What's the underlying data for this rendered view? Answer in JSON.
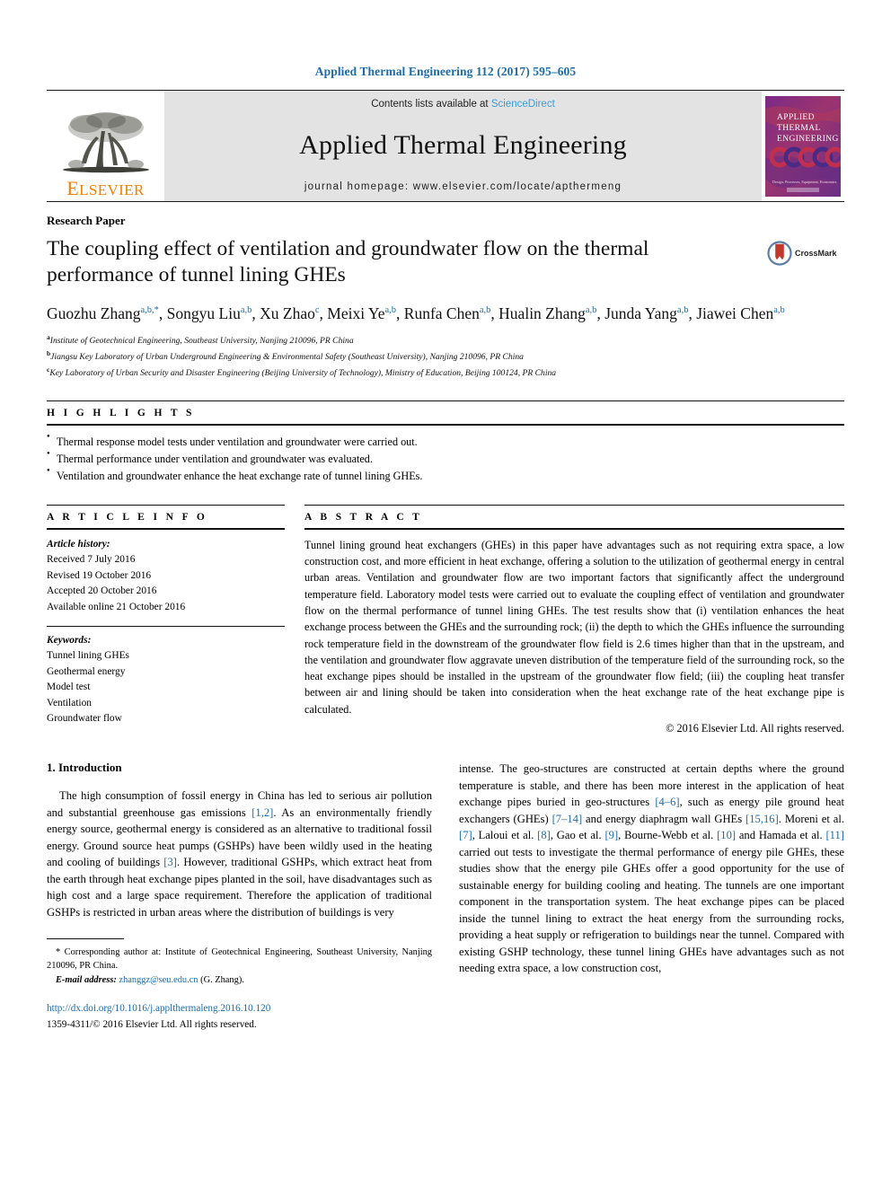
{
  "running_head": "Applied Thermal Engineering 112 (2017) 595–605",
  "masthead": {
    "publisher": "ELSEVIER",
    "publisher_first": "E",
    "publisher_rest": "LSEVIER",
    "contents_prefix": "Contents lists available at ",
    "contents_link": "ScienceDirect",
    "journal_name": "Applied Thermal Engineering",
    "homepage": "journal homepage: www.elsevier.com/locate/apthermeng",
    "cover": {
      "line1": "APPLIED",
      "line2": "THERMAL",
      "line3": "ENGINEERING",
      "footer": "Design, Processes, Equipment, Economics",
      "colors": {
        "top": "#6e2a7a",
        "mid": "#b63a52",
        "accent": "#d0394f",
        "dark": "#4a2b7a"
      }
    }
  },
  "article_type": "Research Paper",
  "title": "The coupling effect of ventilation and groundwater flow on the thermal performance of tunnel lining GHEs",
  "crossmark": {
    "label": "CrossMark"
  },
  "authors": [
    {
      "name": "Guozhu Zhang",
      "sup": "a,b,*"
    },
    {
      "name": "Songyu Liu",
      "sup": "a,b"
    },
    {
      "name": "Xu Zhao",
      "sup": "c"
    },
    {
      "name": "Meixi Ye",
      "sup": "a,b"
    },
    {
      "name": "Runfa Chen",
      "sup": "a,b"
    },
    {
      "name": "Hualin Zhang",
      "sup": "a,b"
    },
    {
      "name": "Junda Yang",
      "sup": "a,b"
    },
    {
      "name": "Jiawei Chen",
      "sup": "a,b"
    }
  ],
  "affiliations": [
    {
      "mark": "a",
      "text": "Institute of Geotechnical Engineering, Southeast University, Nanjing 210096, PR China"
    },
    {
      "mark": "b",
      "text": "Jiangsu Key Laboratory of Urban Underground Engineering & Environmental Safety (Southeast University), Nanjing 210096, PR China"
    },
    {
      "mark": "c",
      "text": "Key Laboratory of Urban Security and Disaster Engineering (Beijing University of Technology), Ministry of Education, Beijing 100124, PR China"
    }
  ],
  "highlights": {
    "heading": "H I G H L I G H T S",
    "items": [
      "Thermal response model tests under ventilation and groundwater were carried out.",
      "Thermal performance under ventilation and groundwater was evaluated.",
      "Ventilation and groundwater enhance the heat exchange rate of tunnel lining GHEs."
    ]
  },
  "article_info": {
    "heading": "A R T I C L E    I N F O",
    "history_label": "Article history:",
    "history": [
      "Received 7 July 2016",
      "Revised 19 October 2016",
      "Accepted 20 October 2016",
      "Available online 21 October 2016"
    ],
    "keywords_label": "Keywords:",
    "keywords": [
      "Tunnel lining GHEs",
      "Geothermal energy",
      "Model test",
      "Ventilation",
      "Groundwater flow"
    ]
  },
  "abstract": {
    "heading": "A B S T R A C T",
    "text": "Tunnel lining ground heat exchangers (GHEs) in this paper have advantages such as not requiring extra space, a low construction cost, and more efficient in heat exchange, offering a solution to the utilization of geothermal energy in central urban areas. Ventilation and groundwater flow are two important factors that significantly affect the underground temperature field. Laboratory model tests were carried out to evaluate the coupling effect of ventilation and groundwater flow on the thermal performance of tunnel lining GHEs. The test results show that (i) ventilation enhances the heat exchange process between the GHEs and the surrounding rock; (ii) the depth to which the GHEs influence the surrounding rock temperature field in the downstream of the groundwater flow field is 2.6 times higher than that in the upstream, and the ventilation and groundwater flow aggravate uneven distribution of the temperature field of the surrounding rock, so the heat exchange pipes should be installed in the upstream of the groundwater flow field; (iii) the coupling heat transfer between air and lining should be taken into consideration when the heat exchange rate of the heat exchange pipe is calculated.",
    "copyright": "© 2016 Elsevier Ltd. All rights reserved."
  },
  "introduction": {
    "heading": "1. Introduction",
    "left_para_parts": [
      "The high consumption of fossil energy in China has led to serious air pollution and substantial greenhouse gas emissions ",
      "[1,2]",
      ". As an environmentally friendly energy source, geothermal energy is considered as an alternative to traditional fossil energy. Ground source heat pumps (GSHPs) have been wildly used in the heating and cooling of buildings ",
      "[3]",
      ". However, traditional GSHPs, which extract heat from the earth through heat exchange pipes planted in the soil, have disadvantages such as high cost and a large space requirement. Therefore the application of traditional GSHPs is restricted in urban areas where the distribution of buildings is very"
    ],
    "right_para_parts": [
      "intense. The geo-structures are constructed at certain depths where the ground temperature is stable, and there has been more interest in the application of heat exchange pipes buried in geo-structures ",
      "[4–6]",
      ", such as energy pile ground heat exchangers (GHEs) ",
      "[7–14]",
      " and energy diaphragm wall GHEs ",
      "[15,16]",
      ". Moreni et al. ",
      "[7]",
      ", Laloui et al. ",
      "[8]",
      ", Gao et al. ",
      "[9]",
      ", Bourne-Webb et al. ",
      "[10]",
      " and Hamada et al. ",
      "[11]",
      " carried out tests to investigate the thermal performance of energy pile GHEs, these studies show that the energy pile GHEs offer a good opportunity for the use of sustainable energy for building cooling and heating. The tunnels are one important component in the transportation system. The heat exchange pipes can be placed inside the tunnel lining to extract the heat energy from the surrounding rocks, providing a heat supply or refrigeration to buildings near the tunnel. Compared with existing GSHP technology, these tunnel lining GHEs have advantages such as not needing extra space, a low construction cost,"
    ]
  },
  "footnote": {
    "corresponding_mark": "*",
    "corresponding_text": "Corresponding author at: Institute of Geotechnical Engineering, Southeast University, Nanjing 210096, PR China.",
    "email_label": "E-mail address:",
    "email": "zhanggz@seu.edu.cn",
    "email_suffix": "(G. Zhang)."
  },
  "doi": {
    "url": "http://dx.doi.org/10.1016/j.applthermaleng.2016.10.120",
    "issn_line": "1359-4311/© 2016 Elsevier Ltd. All rights reserved."
  },
  "colors": {
    "link": "#1b6ca8",
    "elsevier_orange": "#f08000",
    "sciencedirect": "#3a9bd4"
  }
}
